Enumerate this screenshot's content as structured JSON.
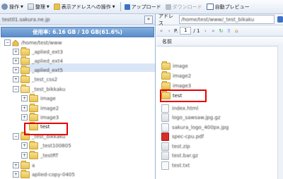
{
  "toolbar": {
    "ops_label": "操作",
    "organize_label": "整理",
    "display_addr_ops_label": "表示アドレスへの操作",
    "upload_label": "アップロード",
    "download_label": "ダウンロード",
    "auto_preview_label": "自動プレビュー"
  },
  "left": {
    "domain_text": "test01.sakura.ne.jp",
    "usage_text": "使用率: 6.16 GB / 10 GB(61.6%)",
    "collapse_label": "«",
    "tree": [
      {
        "label": "/home/test/www",
        "expander": "−"
      },
      {
        "label": "_aplied_ext3",
        "expander": "+"
      },
      {
        "label": "_aplied_ext4",
        "expander": "+"
      },
      {
        "label": "_aplied_ext5",
        "expander": "+"
      },
      {
        "label": "_test_css2",
        "expander": "+"
      },
      {
        "label": "_test_bikkaku",
        "expander": "−"
      },
      {
        "label": "image",
        "expander": "+"
      },
      {
        "label": "image2",
        "expander": "+"
      },
      {
        "label": "image3",
        "expander": "+"
      },
      {
        "label": "test",
        "expander": ""
      },
      {
        "label": "_test_bikkaku",
        "expander": "−"
      },
      {
        "label": "_test100805",
        "expander": "+"
      },
      {
        "label": "_testRT",
        "expander": "+"
      },
      {
        "label": "a",
        "expander": "+"
      },
      {
        "label": "aplied-copy-0405",
        "expander": "+"
      }
    ]
  },
  "right": {
    "addr_label": "アドレス",
    "addr_value": "/home/test/www/_test_bikaku",
    "page_label": "P.",
    "page_value": "1",
    "page_total": "/ 1",
    "col_name": "名前",
    "files": [
      {
        "name": "image",
        "type": "folder"
      },
      {
        "name": "image2",
        "type": "folder"
      },
      {
        "name": "image3",
        "type": "folder"
      },
      {
        "name": "test",
        "type": "folder"
      },
      {
        "name": "index.html",
        "type": "file"
      },
      {
        "name": "logo_sawsaw.jpg.gz",
        "type": "gz"
      },
      {
        "name": "sakura_logo_400px.jpg",
        "type": "img"
      },
      {
        "name": "spec-cpu.pdf",
        "type": "pdf"
      },
      {
        "name": "test.zip",
        "type": "gz"
      },
      {
        "name": "test.bar.gz",
        "type": "gz"
      },
      {
        "name": "test.txt",
        "type": "file"
      }
    ]
  },
  "colors": {
    "highlight": "#e60000",
    "usage_bar": "#5b8dc9",
    "selection": "#d9e6f7"
  }
}
